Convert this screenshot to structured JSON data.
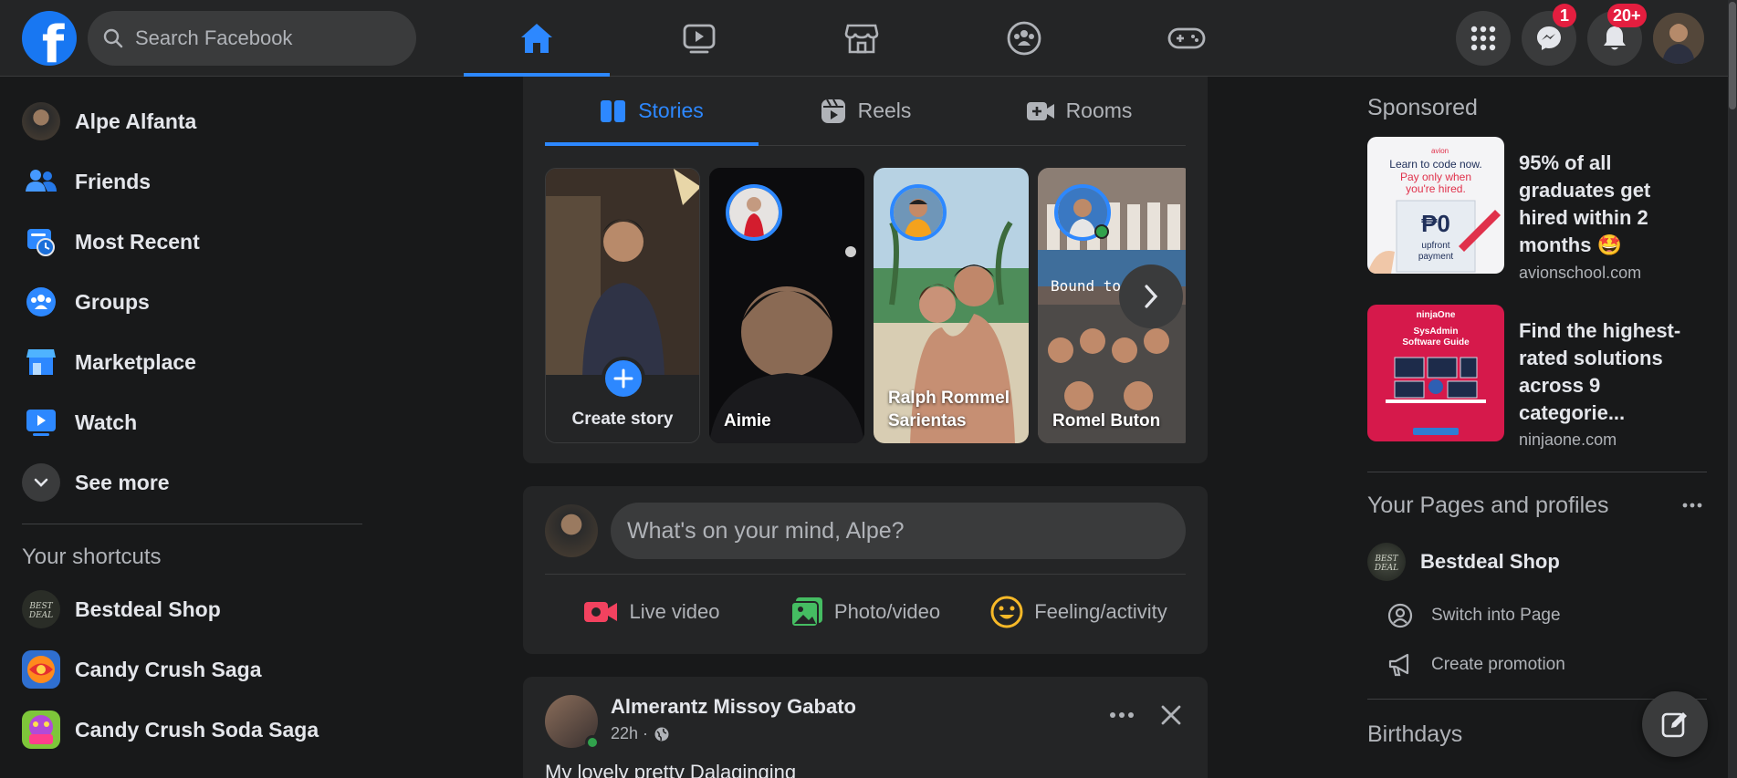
{
  "header": {
    "logo_letter": "f",
    "search_placeholder": "Search Facebook",
    "nav": [
      {
        "icon": "home-icon",
        "active": true
      },
      {
        "icon": "video-icon",
        "active": false
      },
      {
        "icon": "marketplace-icon",
        "active": false
      },
      {
        "icon": "groups-icon",
        "active": false
      },
      {
        "icon": "gaming-icon",
        "active": false
      }
    ],
    "messenger_badge": "1",
    "notifications_badge": "20+",
    "accent": "#2d88ff",
    "badge_color": "#e41e3f"
  },
  "sidebar": {
    "items": [
      {
        "label": "Alpe Alfanta",
        "icon": "profile-avatar"
      },
      {
        "label": "Friends",
        "icon": "friends-icon"
      },
      {
        "label": "Most Recent",
        "icon": "most-recent-icon"
      },
      {
        "label": "Groups",
        "icon": "groups-icon"
      },
      {
        "label": "Marketplace",
        "icon": "marketplace-icon"
      },
      {
        "label": "Watch",
        "icon": "watch-icon"
      },
      {
        "label": "See more",
        "icon": "chevron-down-icon"
      }
    ],
    "shortcuts_title": "Your shortcuts",
    "shortcuts": [
      {
        "label": "Bestdeal Shop"
      },
      {
        "label": "Candy Crush Saga"
      },
      {
        "label": "Candy Crush Soda Saga"
      }
    ]
  },
  "stories": {
    "tabs": [
      {
        "label": "Stories",
        "active": true
      },
      {
        "label": "Reels",
        "active": false
      },
      {
        "label": "Rooms",
        "active": false
      }
    ],
    "create_label": "Create story",
    "items": [
      {
        "name": "Aimie"
      },
      {
        "name": "Ralph Rommel Sarientas"
      },
      {
        "name": "Romel Buton"
      }
    ]
  },
  "composer": {
    "placeholder": "What's on your mind, Alpe?",
    "actions": [
      {
        "label": "Live video",
        "color": "#f3425f"
      },
      {
        "label": "Photo/video",
        "color": "#45bd62"
      },
      {
        "label": "Feeling/activity",
        "color": "#f7b928"
      }
    ]
  },
  "post": {
    "author": "Almerantz Missoy Gabato",
    "time": "22h ·",
    "text": "My lovely pretty Dalaginging"
  },
  "right": {
    "sponsored_title": "Sponsored",
    "ads": [
      {
        "headline": "95% of all graduates get hired within 2 months 🤩",
        "domain": "avionschool.com",
        "thumb_lines": [
          "Learn to code now.",
          "Pay only when",
          "you're hired.",
          "₱0",
          "upfront",
          "payment",
          "avion"
        ]
      },
      {
        "headline": "Find the highest-rated solutions across 9 categorie...",
        "domain": "ninjaone.com",
        "thumb_lines": [
          "ninjaOne",
          "SysAdmin",
          "Software Guide"
        ]
      }
    ],
    "pages_title": "Your Pages and profiles",
    "page_name": "Bestdeal Shop",
    "switch_label": "Switch into Page",
    "promo_label": "Create promotion",
    "birthdays_title": "Birthdays"
  }
}
